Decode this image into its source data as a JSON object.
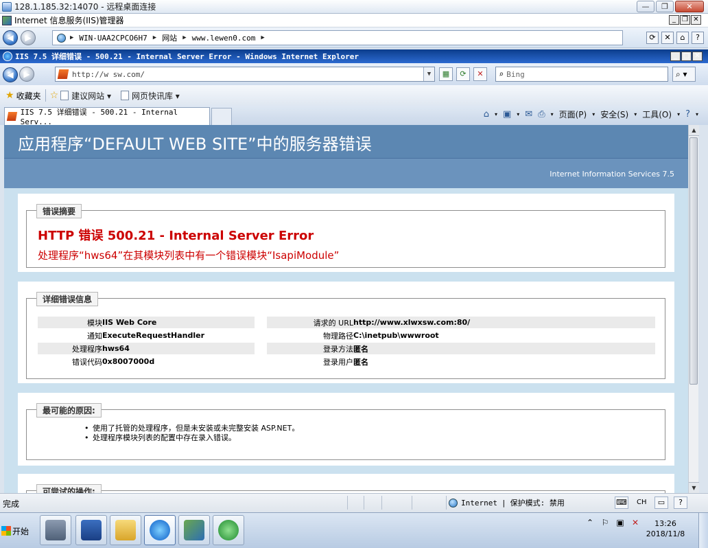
{
  "rdp": {
    "title": "128.1.185.32:14070 - 远程桌面连接"
  },
  "iis": {
    "title": "Internet 信息服务(IIS)管理器",
    "breadcrumbs": [
      "WIN-UAA2CPCO6H7",
      "网站",
      "www.lewen0.com"
    ]
  },
  "ie": {
    "title": "IIS 7.5 详细错误 - 500.21 - Internal Server Error - Windows Internet Explorer",
    "address": "http://w         sw.com/",
    "search_placeholder": "Bing",
    "favorites_label": "收藏夹",
    "fav_items": [
      "建议网站 ▾",
      "网页快讯库 ▾"
    ],
    "tab_title": "IIS 7.5 详细错误 - 500.21 - Internal Serv...",
    "cmd": {
      "page": "页面(P)",
      "safety": "安全(S)",
      "tools": "工具(O)"
    }
  },
  "page": {
    "header": "应用程序“DEFAULT WEB SITE”中的服务器错误",
    "subheader": "Internet Information Services 7.5",
    "summary": {
      "legend": "错误摘要",
      "heading": "HTTP 错误 500.21 - Internal Server Error",
      "message": "处理程序“hws64”在其模块列表中有一个错误模块“IsapiModule”"
    },
    "details": {
      "legend": "详细错误信息",
      "left": [
        {
          "k": "模块",
          "v": "IIS Web Core"
        },
        {
          "k": "通知",
          "v": "ExecuteRequestHandler"
        },
        {
          "k": "处理程序",
          "v": "hws64"
        },
        {
          "k": "错误代码",
          "v": "0x8007000d"
        }
      ],
      "right": [
        {
          "k": "请求的 URL",
          "v": "http://www.xlwxsw.com:80/"
        },
        {
          "k": "物理路径",
          "v": "C:\\inetpub\\wwwroot"
        },
        {
          "k": "登录方法",
          "v": "匿名"
        },
        {
          "k": "登录用户",
          "v": "匿名"
        }
      ]
    },
    "causes": {
      "legend": "最可能的原因:",
      "items": [
        "使用了托管的处理程序，但是未安装或未完整安装 ASP.NET。",
        "处理程序模块列表的配置中存在录入错误。"
      ]
    },
    "actions": {
      "legend": "可尝试的操作:"
    }
  },
  "status": {
    "done": "完成",
    "zone": "Internet",
    "protect": "保护模式: 禁用",
    "lang": "CH"
  },
  "taskbar": {
    "start": "开始",
    "time": "13:26",
    "date": "2018/11/8"
  }
}
